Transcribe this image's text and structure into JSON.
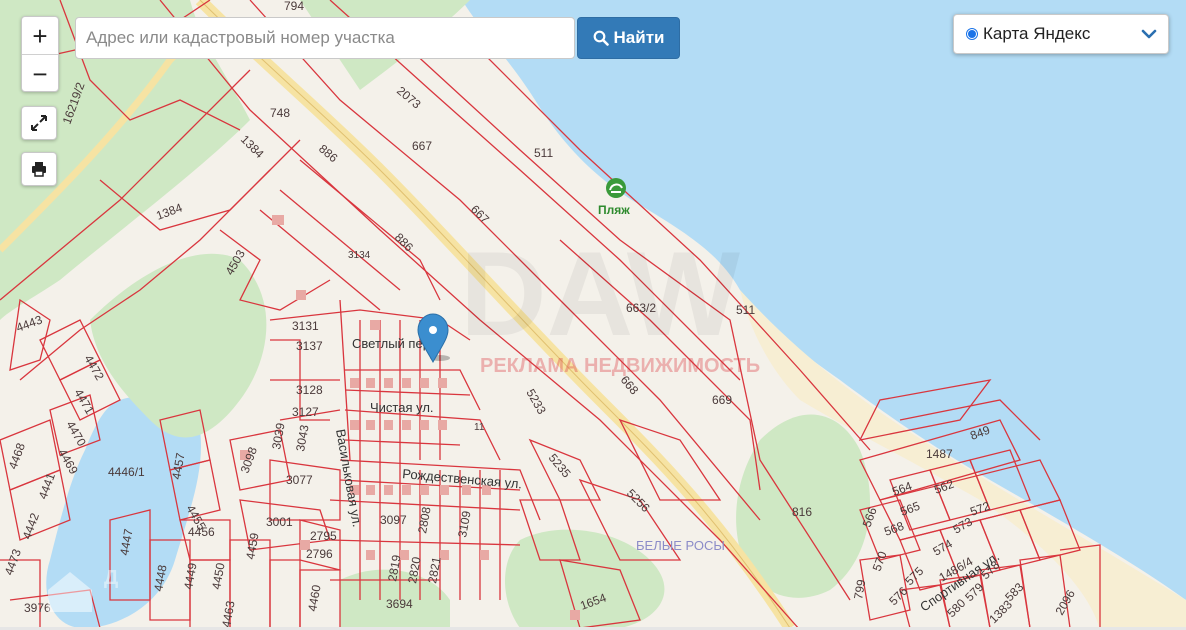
{
  "search": {
    "placeholder": "Адрес или кадастровый номер участка",
    "value": "",
    "button_label": "Найти"
  },
  "zoom": {
    "in_label": "+",
    "out_label": "−"
  },
  "layer_selector": {
    "selected": "Карта Яндекс"
  },
  "icons": {
    "search": "search-icon",
    "fullscreen": "fullscreen-icon",
    "print": "printer-icon",
    "chevron": "chevron-down-icon",
    "marker": "map-marker-icon",
    "beach": "beach-icon"
  },
  "colors": {
    "water": "#b3dcf5",
    "forest": "#cfe8c4",
    "land": "#f4f1ea",
    "parcel": "#d9363e",
    "road": "#f6e3a3",
    "marker": "#3b8ecf",
    "button": "#337ab7"
  },
  "map": {
    "poi": {
      "beach": "Пляж",
      "district": "БЕЛЫЕ РОСЫ"
    },
    "streets": {
      "svetly": "Светлый пер.",
      "chistaya": "Чистая ул.",
      "vasilkovaya": "Васильковая ул.",
      "rozhdestvenskaya": "Рождественская ул.",
      "sportivnaya": "Спортивная ул."
    },
    "watermark": "РЕКЛАМА НЕДВИЖИМОСТЬ",
    "parcels": {
      "p794": "794",
      "p748": "748",
      "p2073": "2073",
      "p16219": "16219/2",
      "p1384a": "1384",
      "p1384b": "1384",
      "p886a": "886",
      "p886b": "886",
      "p667a": "667",
      "p667b": "667",
      "p511a": "511",
      "p511b": "511",
      "p663": "663/2",
      "p668": "668",
      "p669": "669",
      "p4503": "4503",
      "p3134": "3134",
      "p3131": "3131",
      "p3137": "3137",
      "p3128": "3128",
      "p3127": "3127",
      "p3039": "3039",
      "p3043": "3043",
      "p3098": "3098",
      "p3077": "3077",
      "p3001": "3001",
      "p2795": "2795",
      "p2796": "2796",
      "p3097": "3097",
      "p2819": "2819",
      "p2820": "2820",
      "p2821": "2821",
      "p2808": "2808",
      "p3109": "3109",
      "p3694": "3694",
      "p1654": "1654",
      "p5233": "5233",
      "p5235": "5235",
      "p5256": "5256",
      "p816": "816",
      "p849": "849",
      "p1487": "1487",
      "p564": "564",
      "p562": "562",
      "p572": "572",
      "p565": "565",
      "p566": "566",
      "p568": "568",
      "p573": "573",
      "p574": "574",
      "p570": "570",
      "p575": "575",
      "p576": "576",
      "p578": "578",
      "p579": "579",
      "p580": "580",
      "p583": "583",
      "p1383": "1383",
      "p2096": "2096",
      "p799": "799",
      "p14864": "1486/4",
      "p4443": "4443",
      "p4472": "4472",
      "p4471": "4471",
      "p4470": "4470",
      "p4469": "4469",
      "p4468": "4468",
      "p4441": "4441",
      "p4442": "4442",
      "p4446": "4446/1",
      "p4457": "4457",
      "p4455": "4455",
      "p4456": "4456",
      "p4447": "4447",
      "p4448": "4448",
      "p4449": "4449",
      "p4450": "4450",
      "p4459": "4459",
      "p4460": "4460",
      "p4463": "4463",
      "p3976": "3976",
      "p4473": "4473",
      "p11": "11"
    }
  }
}
